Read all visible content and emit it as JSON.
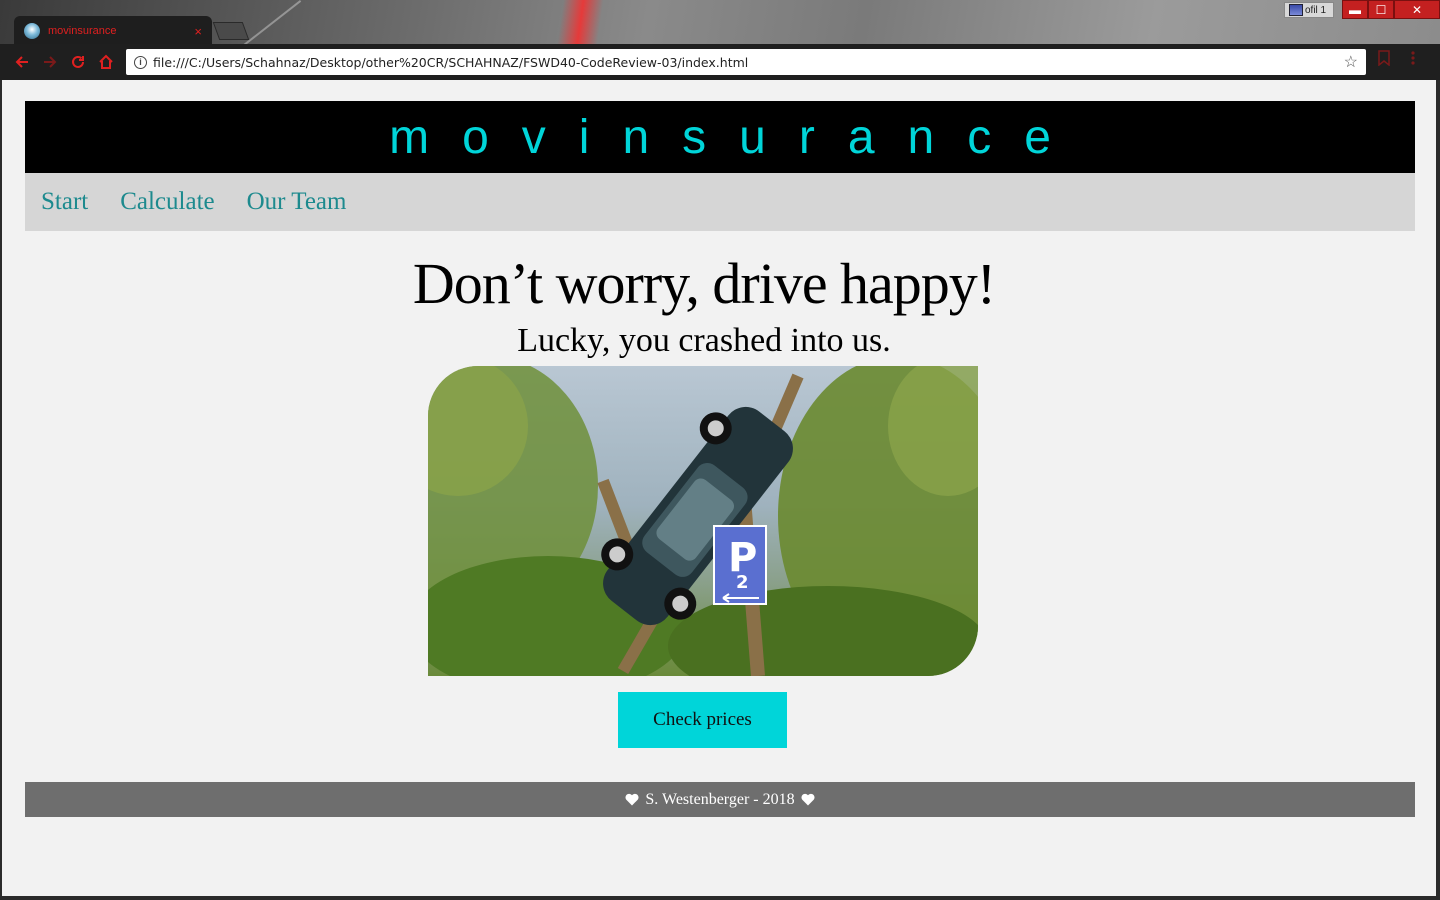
{
  "browser": {
    "tab_title": "movinsurance",
    "tab_close": "×",
    "profile_label": "ofil 1",
    "url": "file:///C:/Users/Schahnaz/Desktop/other%20CR/SCHAHNAZ/FSWD40-CodeReview-03/index.html",
    "info_glyph": "i",
    "star_glyph": "☆",
    "minimize": "▬",
    "maximize": "☐",
    "close": "✕"
  },
  "site": {
    "brand": "movinsurance",
    "nav": [
      {
        "label": "Start"
      },
      {
        "label": "Calculate"
      },
      {
        "label": "Our Team"
      }
    ],
    "hero_title": "Don’t worry, drive happy!",
    "hero_subtitle": "Lucky, you crashed into us.",
    "hero_image": {
      "parking_sign": "P",
      "parking_sub": "2"
    },
    "cta_label": "Check prices",
    "footer_text": "S. Westenberger - 2018"
  },
  "colors": {
    "accent": "#00d5d9",
    "nav_link": "#1d8a8e",
    "header_bg": "#000000",
    "nav_bg": "#d6d6d6",
    "footer_bg": "#6e6e6e",
    "browser_accent": "#e02020"
  },
  "icons": {
    "back": "back-arrow-icon",
    "forward": "forward-arrow-icon",
    "reload": "reload-icon",
    "home": "home-icon",
    "bookmark": "bookmark-icon",
    "menu": "kebab-menu-icon",
    "heart": "heart-icon"
  }
}
